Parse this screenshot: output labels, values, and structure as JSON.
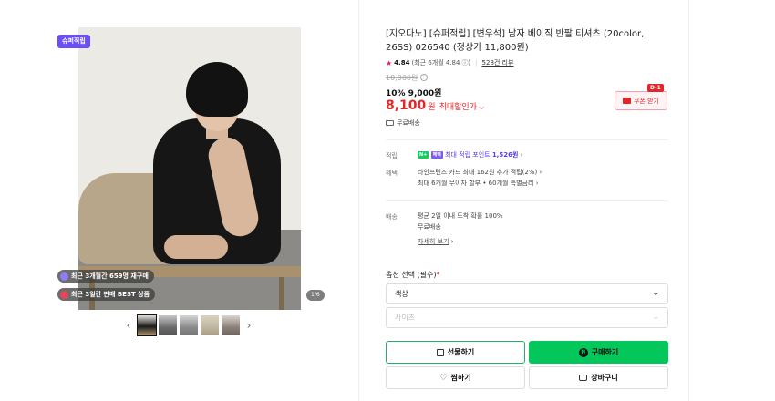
{
  "gallery": {
    "super_badge": "슈퍼적립",
    "pill_repurchase": "최근 3개월간 659명 재구매",
    "pill_best": "최근 3일간 판매 BEST 상품",
    "counter": "1/6",
    "prev_arrow": "‹",
    "next_arrow": "›",
    "thumb_count": 5
  },
  "product": {
    "title": "[지오다노] [슈퍼적립] [변우석] 남자 베이직 반팔 티셔츠 (20color, 26SS) 026540 (정상가 11,800원)",
    "rating_score": "4.84",
    "rating_detail": "(최근 6개월 4.84",
    "reviews": "528건 리뷰",
    "original_price": "10,000원",
    "discount_line": "10% 9,000원",
    "max_price": "8,100",
    "max_unit": "원",
    "max_label": "최대할인가",
    "coupon_label": "쿠폰 받기",
    "dday": "D-1",
    "shipping_free": "무료배송"
  },
  "benefits": {
    "points_label": "적립",
    "points_badge1": "N+",
    "points_badge2": "혜택",
    "points_text": "최대 적립 포인트",
    "points_value": "1,526원",
    "benefit_label": "혜택",
    "benefit_line1": "라인프렌즈 카드 최대 162원 추가 적립(2%)",
    "benefit_line2": "최대 6개월 무이자 할부 • 60개월 특별금리",
    "delivery_label": "배송",
    "delivery_line1": "평균 2일 이내 도착 확률 100%",
    "delivery_line2": "무료배송",
    "delivery_more": "자세히 보기"
  },
  "options": {
    "label": "옵션 선택 (필수)",
    "required_mark": "*",
    "color_select": "색상",
    "size_select": "사이즈"
  },
  "actions": {
    "gift": "선물하기",
    "buy": "구매하기",
    "wish": "찜하기",
    "cart": "장바구니"
  },
  "colors": {
    "accent_red": "#e52528",
    "naver_green": "#03c75a",
    "super_purple": "#6b4ef6"
  }
}
